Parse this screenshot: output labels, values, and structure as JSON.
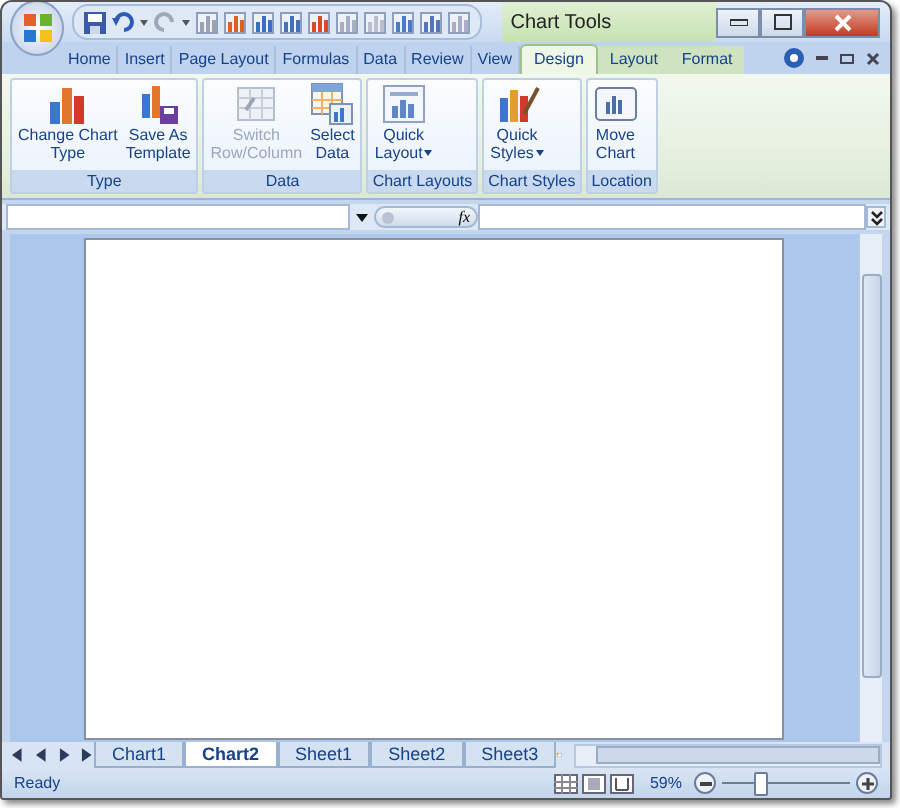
{
  "window": {
    "title": "Chart Tools"
  },
  "tabs": [
    {
      "label": "Home",
      "selected": false,
      "contextual": false
    },
    {
      "label": "Insert",
      "selected": false,
      "contextual": false
    },
    {
      "label": "Page Layout",
      "selected": false,
      "contextual": false
    },
    {
      "label": "Formulas",
      "selected": false,
      "contextual": false
    },
    {
      "label": "Data",
      "selected": false,
      "contextual": false
    },
    {
      "label": "Review",
      "selected": false,
      "contextual": false
    },
    {
      "label": "View",
      "selected": false,
      "contextual": false
    },
    {
      "label": "Design",
      "selected": true,
      "contextual": true
    },
    {
      "label": "Layout",
      "selected": false,
      "contextual": true
    },
    {
      "label": "Format",
      "selected": false,
      "contextual": true
    }
  ],
  "ribbon_groups": [
    {
      "label": "Type",
      "buttons": [
        {
          "kind": "chart",
          "label": "Change Chart Type",
          "disabled": false,
          "menu": false
        },
        {
          "kind": "template",
          "label": "Save As Template",
          "disabled": false,
          "menu": false
        }
      ]
    },
    {
      "label": "Data",
      "buttons": [
        {
          "kind": "switch",
          "label": "Switch Row/Column",
          "disabled": true,
          "menu": false
        },
        {
          "kind": "data",
          "label": "Select Data",
          "disabled": false,
          "menu": false
        }
      ]
    },
    {
      "label": "Chart Layouts",
      "buttons": [
        {
          "kind": "layout",
          "label": "Quick Layout",
          "disabled": false,
          "menu": true
        }
      ]
    },
    {
      "label": "Chart Styles",
      "buttons": [
        {
          "kind": "styles",
          "label": "Quick Styles",
          "disabled": false,
          "menu": true
        }
      ]
    },
    {
      "label": "Location",
      "buttons": [
        {
          "kind": "move",
          "label": "Move Chart",
          "disabled": false,
          "menu": false
        }
      ]
    }
  ],
  "formula_bar": {
    "function_button": "fx"
  },
  "sheet_tabs": [
    {
      "label": "Chart1",
      "selected": false
    },
    {
      "label": "Chart2",
      "selected": true
    },
    {
      "label": "Sheet1",
      "selected": false
    },
    {
      "label": "Sheet2",
      "selected": false
    },
    {
      "label": "Sheet3",
      "selected": false
    }
  ],
  "status_bar": {
    "status": "Ready",
    "zoom": "59%",
    "zoom_slider": {
      "level": 0.3
    }
  }
}
